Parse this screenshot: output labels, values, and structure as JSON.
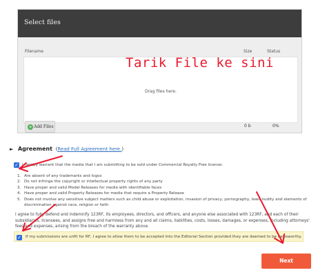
{
  "uploader": {
    "title": "Select files",
    "columns": {
      "filename": "Filename",
      "size": "Size",
      "status": "Status"
    },
    "drop_text": "Drag files here.",
    "add_button": "Add Files",
    "footer_size": "0 b",
    "footer_status": "0%"
  },
  "annotation": {
    "handwritten_text": "Tarik File ke sini",
    "color": "#e8192c"
  },
  "agreement": {
    "title": "Agreement",
    "open_paren": "(",
    "link": "Read Full Agreement here.",
    "close_paren": ")",
    "warranty_text": "I hereby warrant that the media that I am submitting to be sold under Commercial Royalty Free license:",
    "warranty_checked": true,
    "items": [
      {
        "num": "1.",
        "text": "Are absent of any trademarks and logos"
      },
      {
        "num": "2.",
        "text": "Do not infringe the copyright or intellectual property rights of any party"
      },
      {
        "num": "3.",
        "text": "Have proper and valid Model Releases for media with identifiable faces"
      },
      {
        "num": "4.",
        "text": "Have proper and valid Property Releases for media that require a Property Release"
      },
      {
        "num": "5.",
        "text": "Does not involve any sensitive subject matters such as child abuse or exploitation, invasion of privacy, pornography, lewd nudity and elements of"
      },
      {
        "num": "",
        "text": "discrimination against race, religion or faith"
      }
    ],
    "indemnify_text": "I agree to fully defend and indemnify 123RF, its employees, directors, and officers, and anyone else associated with 123RF, and each of their subsidiaries, licensees, and assigns free and harmless from any and all claims, liabilities, costs, losses, damages, or expenses, including attorneys' fees and expenses, arising from the breach of the warranty above.",
    "rf_text": "If my submissions are unfit for RF, I agree to allow them to be accepted into the Editorial Section provided they are deemed to be newsworthy.",
    "rf_checked": true
  },
  "next_button": "Next",
  "colors": {
    "header": "#3d3d3d",
    "accent": "#f05a3a",
    "checkbox": "#2f6fe0",
    "link": "#2a6dc0",
    "highlight": "#fbf5cc"
  }
}
